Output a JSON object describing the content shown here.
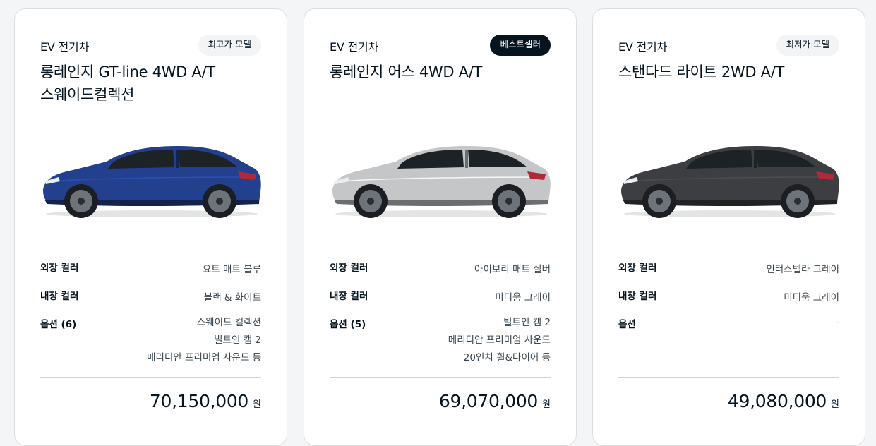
{
  "cards": [
    {
      "category": "EV 전기차",
      "badge": "최고가 모델",
      "title_line1": "롱레인지 GT-line 4WD A/T",
      "title_line2": "스웨이드컬렉션",
      "image_alt": "EV6 요트 매트 블루",
      "car_color": "#23408e",
      "specs": {
        "exterior_label": "외장 컬러",
        "exterior_value": "요트 매트 블루",
        "interior_label": "내장 컬러",
        "interior_value": "블랙 & 화이트",
        "options_label": "옵션 (6)",
        "options": [
          "스웨이드 컬렉션",
          "빌트인 캠 2",
          "메리디안 프리미엄 사운드 등"
        ]
      },
      "price": "70,150,000",
      "currency": "원"
    },
    {
      "category": "EV 전기차",
      "badge": "베스트셀러",
      "title_line1": "롱레인지 어스 4WD A/T",
      "title_line2": "",
      "image_alt": "EV6 아이보리 매트 실버",
      "car_color": "#c4c6c7",
      "specs": {
        "exterior_label": "외장 컬러",
        "exterior_value": "아이보리 매트 실버",
        "interior_label": "내장 컬러",
        "interior_value": "미디움 그레이",
        "options_label": "옵션 (5)",
        "options": [
          "빌트인 캠 2",
          "메리디안 프리미엄 사운드",
          "20인치 휠&타이어 등"
        ]
      },
      "price": "69,070,000",
      "currency": "원"
    },
    {
      "category": "EV 전기차",
      "badge": "최저가 모델",
      "title_line1": "스탠다드 라이트 2WD A/T",
      "title_line2": "",
      "image_alt": "EV6 인터스텔라 그레이",
      "car_color": "#3c3e41",
      "specs": {
        "exterior_label": "외장 컬러",
        "exterior_value": "인터스텔라 그레이",
        "interior_label": "내장 컬러",
        "interior_value": "미디움 그레이",
        "options_label": "옵션",
        "options": [
          "-"
        ]
      },
      "price": "49,080,000",
      "currency": "원"
    }
  ]
}
